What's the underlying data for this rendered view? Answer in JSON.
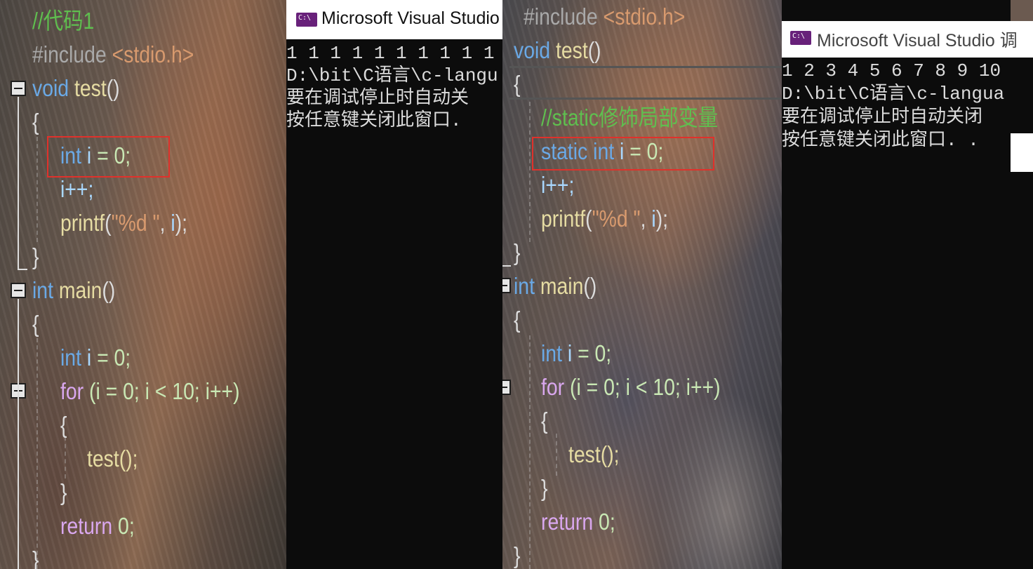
{
  "colors": {
    "highlight_box": "#e0312b",
    "comment": "#5fbf4f",
    "keyword": "#6aa9e6",
    "console_bg": "#0c0c0c"
  },
  "left_editor": {
    "comment": "//代码1",
    "include_directive": "#include",
    "include_header": "<stdio.h>",
    "test_decl": {
      "type": "void",
      "name": "test",
      "parens": "()"
    },
    "brace_open": "{",
    "brace_close": "}",
    "local_decl": {
      "type": "int",
      "var": "i",
      "rest": " = 0;"
    },
    "increment": "i++;",
    "printf": {
      "fn": "printf",
      "open": "(",
      "fmt": "\"%d \"",
      "rest": ", ",
      "var": "i",
      "close": ");"
    },
    "main_decl": {
      "type": "int",
      "name": "main",
      "parens": "()"
    },
    "main_local": {
      "type": "int",
      "var": "i",
      "rest": " = 0;"
    },
    "for_loop": {
      "kw": "for",
      "text": " (i = 0; i < 10; i++)"
    },
    "call": "test();",
    "return": {
      "kw": "return",
      "value": "0;"
    }
  },
  "console_1": {
    "title": "Microsoft Visual Studio",
    "output_line": "1 1 1 1 1 1 1 1 1 1",
    "path_line": "D:\\bit\\C语言\\c-langu",
    "line_3": "要在调试停止时自动关",
    "line_4": "按任意键关闭此窗口."
  },
  "right_editor": {
    "include_directive": "#include",
    "include_header": "<stdio.h>",
    "test_decl": {
      "type": "void",
      "name": "test",
      "parens": "()"
    },
    "brace_open": "{",
    "brace_close": "}",
    "comment": "//static修饰局部变量",
    "static_decl": {
      "storage": "static",
      "type": "int",
      "var": "i",
      "rest": " = 0;"
    },
    "increment": "i++;",
    "printf": {
      "fn": "printf",
      "open": "(",
      "fmt": "\"%d \"",
      "rest": ", ",
      "var": "i",
      "close": ");"
    },
    "main_decl": {
      "type": "int",
      "name": "main",
      "parens": "()"
    },
    "main_local": {
      "type": "int",
      "var": "i",
      "rest": " = 0;"
    },
    "for_loop": {
      "kw": "for",
      "text": " (i = 0; i < 10; i++)"
    },
    "call": "test();",
    "return": {
      "kw": "return",
      "value": "0;"
    }
  },
  "console_2": {
    "title": "Microsoft Visual Studio 调",
    "output_line": "1 2 3 4 5 6 7 8 9 10",
    "path_line": "D:\\bit\\C语言\\c-langua",
    "line_3": "要在调试停止时自动关闭",
    "line_4": "按任意键关闭此窗口. ."
  }
}
